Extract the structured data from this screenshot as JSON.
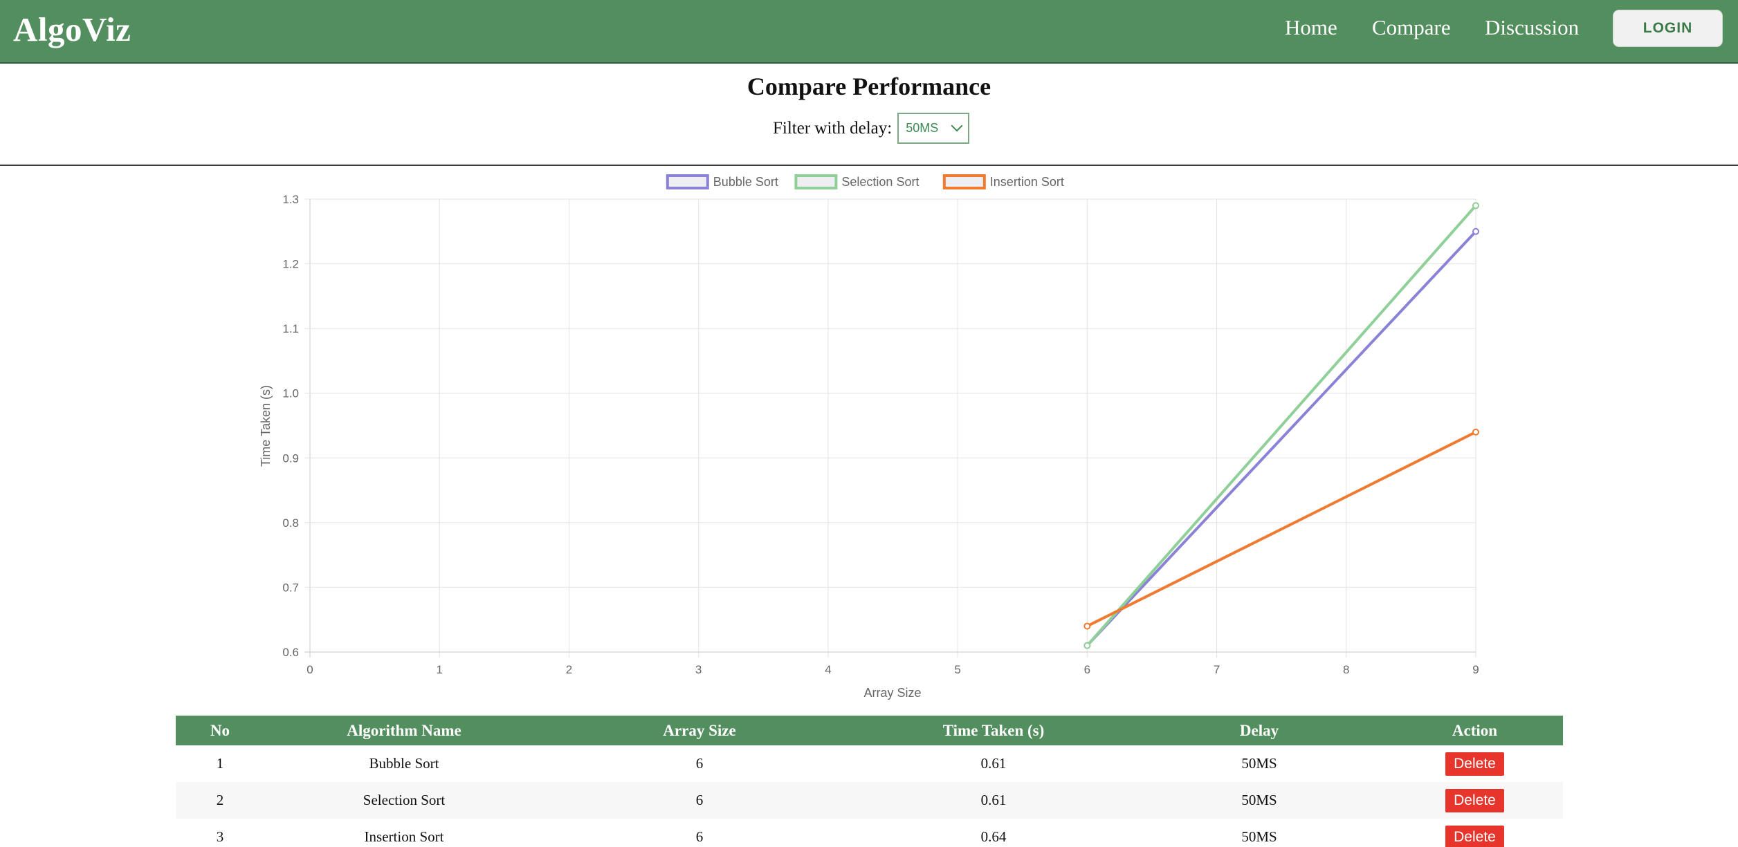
{
  "navbar": {
    "brand": "AlgoViz",
    "links": [
      "Home",
      "Compare",
      "Discussion"
    ],
    "login_label": "LOGIN"
  },
  "page": {
    "title": "Compare Performance",
    "filter_label": "Filter with delay:",
    "filter_value": "50MS"
  },
  "colors": {
    "nav_green": "#538f5e",
    "bubble": "#8a82d6",
    "selection": "#8fcf98",
    "insertion": "#ef7a30",
    "delete_red": "#e8352c"
  },
  "chart_data": {
    "type": "line",
    "xlabel": "Array Size",
    "ylabel": "Time Taken (s)",
    "xlim": [
      0,
      9
    ],
    "ylim": [
      0.6,
      1.3
    ],
    "x_ticks": [
      "0",
      "1",
      "2",
      "3",
      "4",
      "5",
      "6",
      "7",
      "8",
      "9"
    ],
    "y_ticks": [
      "0.6",
      "0.7",
      "0.8",
      "0.9",
      "1.0",
      "1.1",
      "1.2",
      "1.3"
    ],
    "grid": true,
    "legend_position": "top",
    "series": [
      {
        "name": "Bubble Sort",
        "color": "#8a82d6",
        "points": [
          [
            6,
            0.61
          ],
          [
            9,
            1.25
          ]
        ]
      },
      {
        "name": "Selection Sort",
        "color": "#8fcf98",
        "points": [
          [
            6,
            0.61
          ],
          [
            9,
            1.29
          ]
        ]
      },
      {
        "name": "Insertion Sort",
        "color": "#ef7a30",
        "points": [
          [
            6,
            0.64
          ],
          [
            9,
            0.94
          ]
        ]
      }
    ]
  },
  "table": {
    "headers": [
      "No",
      "Algorithm Name",
      "Array Size",
      "Time Taken (s)",
      "Delay",
      "Action"
    ],
    "action_label": "Delete",
    "rows": [
      {
        "no": "1",
        "name": "Bubble Sort",
        "size": "6",
        "time": "0.61",
        "delay": "50MS"
      },
      {
        "no": "2",
        "name": "Selection Sort",
        "size": "6",
        "time": "0.61",
        "delay": "50MS"
      },
      {
        "no": "3",
        "name": "Insertion Sort",
        "size": "6",
        "time": "0.64",
        "delay": "50MS"
      }
    ]
  }
}
